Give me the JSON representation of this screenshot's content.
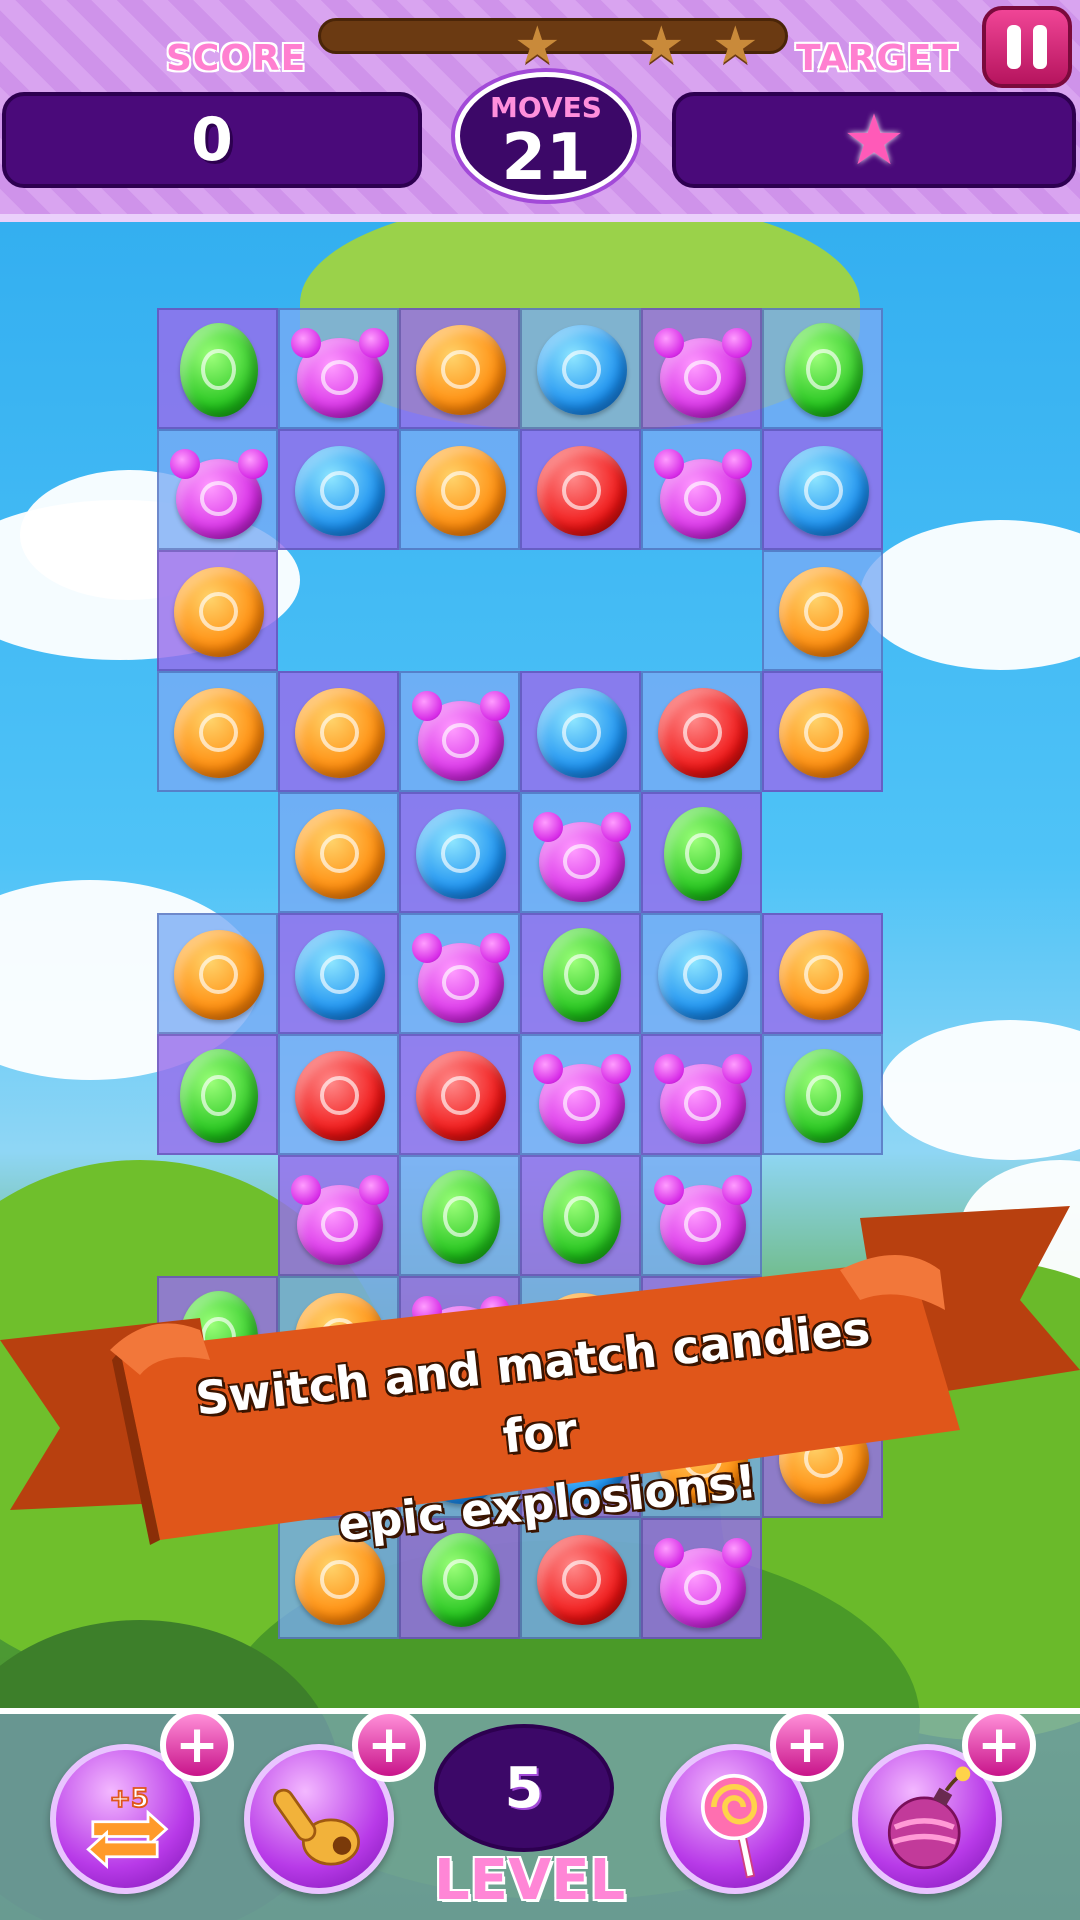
{
  "header": {
    "score_label": "SCORE",
    "score_value": "0",
    "target_label": "TARGET",
    "target_icon": "star-icon",
    "moves_label": "MOVES",
    "moves_value": "21",
    "stars_earned": 0,
    "stars_total": 3,
    "pause_icon": "pause-icon"
  },
  "board": {
    "cells": [
      {
        "r": 0,
        "c": 0,
        "color": "green",
        "shape": "oval"
      },
      {
        "r": 0,
        "c": 1,
        "color": "purple",
        "shape": "bear"
      },
      {
        "r": 0,
        "c": 2,
        "color": "orange",
        "shape": "round"
      },
      {
        "r": 0,
        "c": 3,
        "color": "blue",
        "shape": "round"
      },
      {
        "r": 0,
        "c": 4,
        "color": "purple",
        "shape": "bear"
      },
      {
        "r": 0,
        "c": 5,
        "color": "green",
        "shape": "oval"
      },
      {
        "r": 1,
        "c": 0,
        "color": "purple",
        "shape": "bear"
      },
      {
        "r": 1,
        "c": 1,
        "color": "blue",
        "shape": "round"
      },
      {
        "r": 1,
        "c": 2,
        "color": "orange",
        "shape": "round"
      },
      {
        "r": 1,
        "c": 3,
        "color": "red",
        "shape": "round"
      },
      {
        "r": 1,
        "c": 4,
        "color": "purple",
        "shape": "bear"
      },
      {
        "r": 1,
        "c": 5,
        "color": "blue",
        "shape": "round"
      },
      {
        "r": 2,
        "c": 0,
        "color": "orange",
        "shape": "round"
      },
      {
        "r": 2,
        "c": 5,
        "color": "orange",
        "shape": "round"
      },
      {
        "r": 3,
        "c": 0,
        "color": "orange",
        "shape": "round"
      },
      {
        "r": 3,
        "c": 1,
        "color": "orange",
        "shape": "round"
      },
      {
        "r": 3,
        "c": 2,
        "color": "purple",
        "shape": "bear"
      },
      {
        "r": 3,
        "c": 3,
        "color": "blue",
        "shape": "round"
      },
      {
        "r": 3,
        "c": 4,
        "color": "red",
        "shape": "round"
      },
      {
        "r": 3,
        "c": 5,
        "color": "orange",
        "shape": "round"
      },
      {
        "r": 4,
        "c": 1,
        "color": "orange",
        "shape": "round"
      },
      {
        "r": 4,
        "c": 2,
        "color": "blue",
        "shape": "round"
      },
      {
        "r": 4,
        "c": 3,
        "color": "purple",
        "shape": "bear"
      },
      {
        "r": 4,
        "c": 4,
        "color": "green",
        "shape": "oval"
      },
      {
        "r": 5,
        "c": 0,
        "color": "orange",
        "shape": "round"
      },
      {
        "r": 5,
        "c": 1,
        "color": "blue",
        "shape": "round"
      },
      {
        "r": 5,
        "c": 2,
        "color": "purple",
        "shape": "bear"
      },
      {
        "r": 5,
        "c": 3,
        "color": "green",
        "shape": "oval"
      },
      {
        "r": 5,
        "c": 4,
        "color": "blue",
        "shape": "round"
      },
      {
        "r": 5,
        "c": 5,
        "color": "orange",
        "shape": "round"
      },
      {
        "r": 6,
        "c": 0,
        "color": "green",
        "shape": "oval"
      },
      {
        "r": 6,
        "c": 1,
        "color": "red",
        "shape": "round"
      },
      {
        "r": 6,
        "c": 2,
        "color": "red",
        "shape": "round"
      },
      {
        "r": 6,
        "c": 3,
        "color": "purple",
        "shape": "bear"
      },
      {
        "r": 6,
        "c": 4,
        "color": "purple",
        "shape": "bear"
      },
      {
        "r": 6,
        "c": 5,
        "color": "green",
        "shape": "oval"
      },
      {
        "r": 7,
        "c": 1,
        "color": "purple",
        "shape": "bear"
      },
      {
        "r": 7,
        "c": 2,
        "color": "green",
        "shape": "oval"
      },
      {
        "r": 7,
        "c": 3,
        "color": "green",
        "shape": "oval"
      },
      {
        "r": 7,
        "c": 4,
        "color": "purple",
        "shape": "bear"
      },
      {
        "r": 8,
        "c": 0,
        "color": "green",
        "shape": "oval"
      },
      {
        "r": 8,
        "c": 1,
        "color": "orange",
        "shape": "round"
      },
      {
        "r": 8,
        "c": 2,
        "color": "purple",
        "shape": "bear"
      },
      {
        "r": 8,
        "c": 3,
        "color": "orange",
        "shape": "round"
      },
      {
        "r": 8,
        "c": 4,
        "color": "blue",
        "shape": "round"
      },
      {
        "r": 9,
        "c": 1,
        "color": "orange",
        "shape": "round"
      },
      {
        "r": 9,
        "c": 2,
        "color": "blue",
        "shape": "round"
      },
      {
        "r": 9,
        "c": 3,
        "color": "blue",
        "shape": "round"
      },
      {
        "r": 9,
        "c": 4,
        "color": "orange",
        "shape": "round"
      },
      {
        "r": 9,
        "c": 5,
        "color": "orange",
        "shape": "round"
      },
      {
        "r": 10,
        "c": 1,
        "color": "orange",
        "shape": "round"
      },
      {
        "r": 10,
        "c": 2,
        "color": "green",
        "shape": "oval"
      },
      {
        "r": 10,
        "c": 3,
        "color": "red",
        "shape": "round"
      },
      {
        "r": 10,
        "c": 4,
        "color": "purple",
        "shape": "bear"
      }
    ]
  },
  "banner": {
    "line1": "Switch and match candies for",
    "line2": "epic explosions!"
  },
  "footer": {
    "level_value": "5",
    "level_label": "LEVEL",
    "boosters": [
      {
        "name": "extra-moves-booster",
        "icon": "swap-arrows-icon",
        "badge": "+5"
      },
      {
        "name": "hammer-booster",
        "icon": "pointing-hand-icon"
      },
      {
        "name": "lollipop-booster",
        "icon": "lollipop-icon"
      },
      {
        "name": "bomb-booster",
        "icon": "bomb-icon"
      }
    ],
    "add_icon": "plus-icon"
  },
  "colors": {
    "header_purple": "#d9a4f0",
    "panel_dark": "#4a0a7a",
    "pink_label": "#ff7fd0",
    "ribbon_orange": "#e0561a",
    "pause_pink": "#e02a80"
  }
}
